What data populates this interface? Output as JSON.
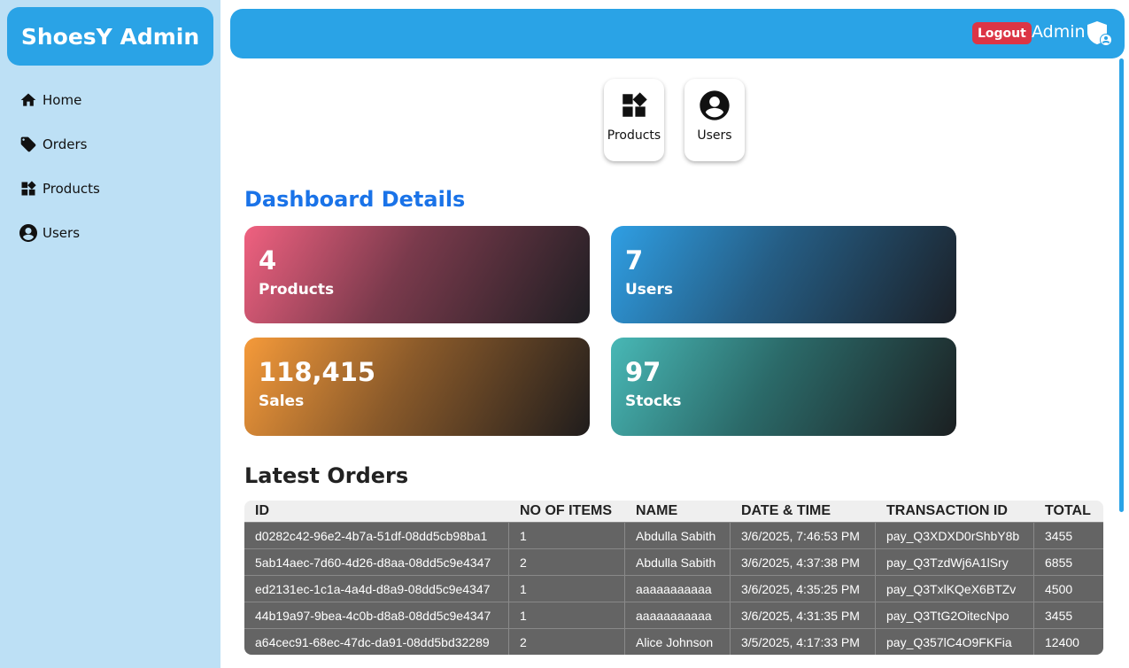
{
  "brand": {
    "title": "ShoesY Admin"
  },
  "sidebar": {
    "items": [
      {
        "label": "Home",
        "icon": "home-icon"
      },
      {
        "label": "Orders",
        "icon": "tag-icon"
      },
      {
        "label": "Products",
        "icon": "widgets-icon"
      },
      {
        "label": "Users",
        "icon": "account-circle-icon"
      }
    ]
  },
  "header": {
    "logout_label": "Logout",
    "user_label": "Admin",
    "user_icon": "admin-shield-icon",
    "color": "#2aa3e6"
  },
  "quick_links": [
    {
      "label": "Products",
      "icon": "widgets-icon"
    },
    {
      "label": "Users",
      "icon": "account-circle-icon"
    }
  ],
  "dashboard": {
    "title": "Dashboard Details",
    "stats": [
      {
        "value": "4",
        "label": "Products"
      },
      {
        "value": "7",
        "label": "Users"
      },
      {
        "value": "118,415",
        "label": "Sales"
      },
      {
        "value": "97",
        "label": "Stocks"
      }
    ]
  },
  "orders": {
    "title": "Latest Orders",
    "columns": [
      "ID",
      "NO OF ITEMS",
      "NAME",
      "DATE & TIME",
      "TRANSACTION ID",
      "TOTAL"
    ],
    "rows": [
      [
        "d0282c42-96e2-4b7a-51df-08dd5cb98ba1",
        "1",
        "Abdulla Sabith",
        "3/6/2025, 7:46:53 PM",
        "pay_Q3XDXD0rShbY8b",
        "3455"
      ],
      [
        "5ab14aec-7d60-4d26-d8aa-08dd5c9e4347",
        "2",
        "Abdulla Sabith",
        "3/6/2025, 4:37:38 PM",
        "pay_Q3TzdWj6A1lSry",
        "6855"
      ],
      [
        "ed2131ec-1c1a-4a4d-d8a9-08dd5c9e4347",
        "1",
        "aaaaaaaaaaa",
        "3/6/2025, 4:35:25 PM",
        "pay_Q3TxlKQeX6BTZv",
        "4500"
      ],
      [
        "44b19a97-9bea-4c0b-d8a8-08dd5c9e4347",
        "1",
        "aaaaaaaaaaa",
        "3/6/2025, 4:31:35 PM",
        "pay_Q3TtG2OitecNpo",
        "3455"
      ],
      [
        "a64cec91-68ec-47dc-da91-08dd5bd32289",
        "2",
        "Alice Johnson",
        "3/5/2025, 4:17:33 PM",
        "pay_Q357lC4O9FKFia",
        "12400"
      ]
    ]
  }
}
